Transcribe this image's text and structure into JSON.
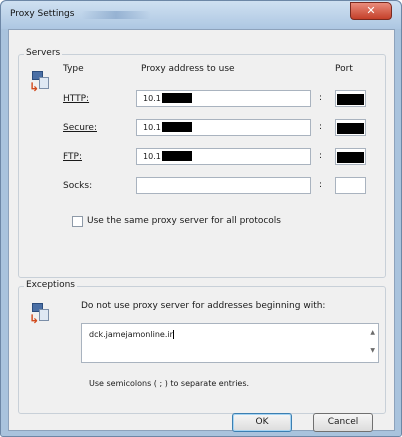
{
  "window": {
    "title": "Proxy Settings",
    "close_glyph": "✕"
  },
  "servers": {
    "group_label": "Servers",
    "header_type": "Type",
    "header_address": "Proxy address to use",
    "header_port": "Port",
    "rows": [
      {
        "type": "HTTP:",
        "address": "10.1",
        "separator": ":"
      },
      {
        "type": "Secure:",
        "address": "10.1",
        "separator": ":"
      },
      {
        "type": "FTP:",
        "address": "10.1",
        "separator": ":"
      },
      {
        "type": "Socks:",
        "address": "",
        "separator": ":"
      }
    ],
    "same_proxy_label": "Use the same proxy server for all protocols",
    "same_proxy_checked": false
  },
  "exceptions": {
    "group_label": "Exceptions",
    "description": "Do not use proxy server for addresses beginning with:",
    "value": "dck.jamejamonline.ir",
    "hint": "Use semicolons ( ; ) to separate entries."
  },
  "buttons": {
    "ok": "OK",
    "cancel": "Cancel"
  },
  "icons": {
    "servers": "network-computers-icon",
    "exceptions": "network-computers-icon",
    "scroll_up": "▲",
    "scroll_down": "▼"
  },
  "colors": {
    "titlebar": "#adc7e2",
    "close_button": "#c4402a",
    "dialog_bg": "#f0f0f0"
  }
}
